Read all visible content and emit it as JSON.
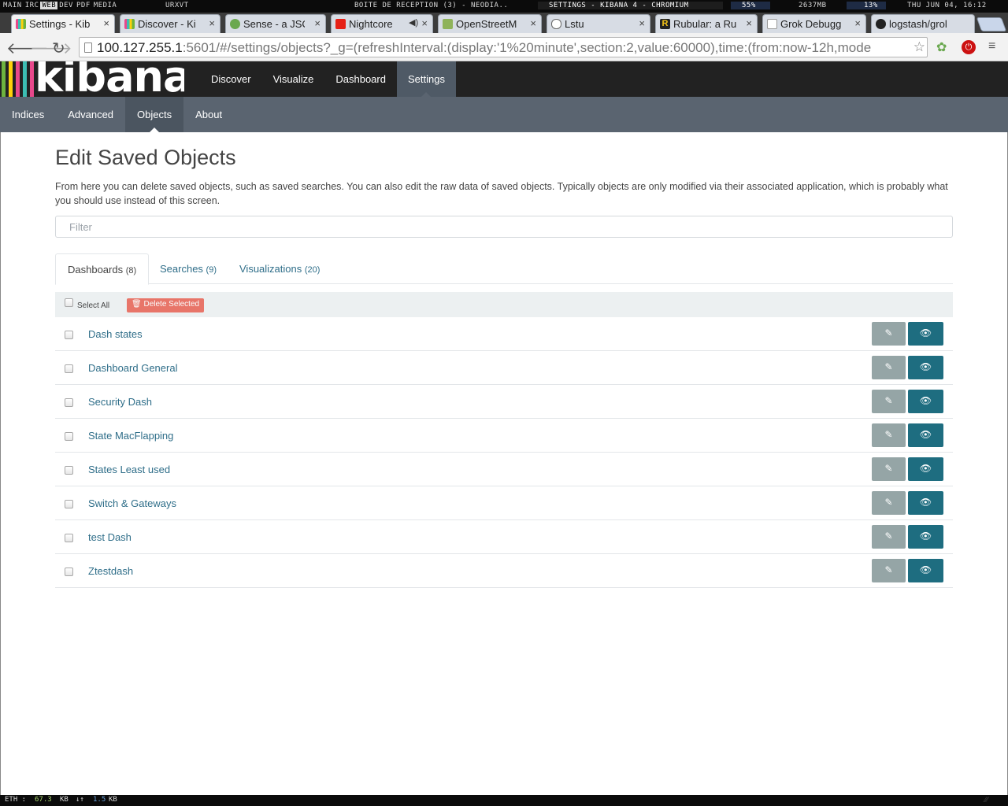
{
  "system_bar": {
    "workspaces": [
      "main",
      "irc",
      "web",
      "dev",
      "pdf",
      "media",
      "urxvt"
    ],
    "active_workspace": "web",
    "window_titles": [
      "Boîte de réception (3) - neodia..",
      "Settings - Kibana 4 - Chromium"
    ],
    "volume": "55%",
    "memory": "2637mb",
    "cpu": "13%",
    "clock": "Thu Jun 04, 16:12"
  },
  "browser": {
    "tabs": [
      {
        "title": "Settings - Kib",
        "active": true
      },
      {
        "title": "Discover - Ki",
        "active": false
      },
      {
        "title": "Sense - a JSC",
        "active": false
      },
      {
        "title": "Nightcore",
        "active": false
      },
      {
        "title": "OpenStreetM",
        "active": false
      },
      {
        "title": "Lstu",
        "active": false
      },
      {
        "title": "Rubular: a Ru",
        "active": false
      },
      {
        "title": "Grok Debugg",
        "active": false
      },
      {
        "title": "logstash/grol",
        "active": false
      }
    ],
    "close_glyph": "×",
    "url_host": "100.127.255.1",
    "url_rest": ":5601/#/settings/objects?_g=(refreshInterval:(display:'1%20minute',section:2,value:60000),time:(from:now-12h,mode"
  },
  "kibana": {
    "logo_text": "kibana",
    "logo_colors": [
      "#e8488b",
      "#3cbeb3",
      "#fed10a",
      "#6db33f",
      "#e8488b"
    ],
    "top_nav": [
      "Discover",
      "Visualize",
      "Dashboard",
      "Settings"
    ],
    "active_top_nav": "Settings",
    "sub_nav": [
      "Indices",
      "Advanced",
      "Objects",
      "About"
    ],
    "active_sub_nav": "Objects"
  },
  "page": {
    "title": "Edit Saved Objects",
    "description": "From here you can delete saved objects, such as saved searches. You can also edit the raw data of saved objects. Typically objects are only modified via their associated application, which is probably what you should use instead of this screen.",
    "filter_placeholder": "Filter",
    "object_tabs": [
      {
        "label": "Dashboards",
        "count": "(8)"
      },
      {
        "label": "Searches",
        "count": "(9)"
      },
      {
        "label": "Visualizations",
        "count": "(20)"
      }
    ],
    "select_all_label": "Select All",
    "delete_selected_label": "Delete Selected",
    "objects": [
      "Dash states",
      "Dashboard General",
      "Security Dash",
      "State MacFlapping",
      "States Least used",
      "Switch & Gateways",
      "test Dash",
      "Ztestdash"
    ]
  },
  "bottom_bar": {
    "label": "eth :",
    "down_value": "67.3",
    "down_unit": "kb",
    "arrows": "↓↑",
    "up_value": "1.5",
    "up_unit": "kb"
  },
  "colors": {
    "link": "#2f6e89",
    "edit_button": "#95a5a6",
    "view_button": "#1e6d80",
    "danger": "#e74c3c"
  }
}
